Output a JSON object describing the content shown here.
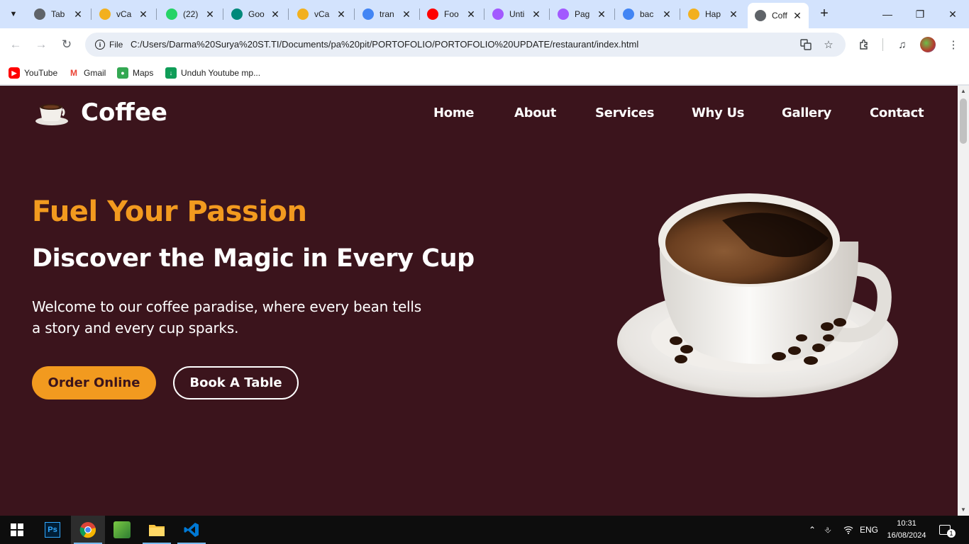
{
  "browser": {
    "tabs": [
      {
        "title": "Tab",
        "favicon": "chrome-icon",
        "color": "#5f6368"
      },
      {
        "title": "vCa",
        "favicon": "vcard-icon",
        "color": "#f2b01e"
      },
      {
        "title": "(22)",
        "favicon": "whatsapp-icon",
        "color": "#25d366"
      },
      {
        "title": "Goo",
        "favicon": "google-meet-icon",
        "color": "#00897b"
      },
      {
        "title": "vCa",
        "favicon": "vcard-icon",
        "color": "#f2b01e"
      },
      {
        "title": "tran",
        "favicon": "google-icon",
        "color": "#4285f4"
      },
      {
        "title": "Foo",
        "favicon": "youtube-icon",
        "color": "#ff0000"
      },
      {
        "title": "Unti",
        "favicon": "figma-icon",
        "color": "#a259ff"
      },
      {
        "title": "Pag",
        "favicon": "figma-icon",
        "color": "#a259ff"
      },
      {
        "title": "bac",
        "favicon": "google-icon",
        "color": "#4285f4"
      },
      {
        "title": "Hap",
        "favicon": "happy-icon",
        "color": "#f2b01e"
      },
      {
        "title": "Coff",
        "favicon": "globe-icon",
        "color": "#5f6368"
      }
    ],
    "active_tab": 11,
    "url_scheme": "File",
    "url": "C:/Users/Darma%20Surya%20ST.TI/Documents/pa%20pit/PORTOFOLIO/PORTOFOLIO%20UPDATE/restaurant/index.html",
    "bookmarks": [
      {
        "label": "YouTube",
        "icon": "youtube-icon",
        "color": "#ff0000"
      },
      {
        "label": "Gmail",
        "icon": "gmail-icon",
        "color": "#ea4335"
      },
      {
        "label": "Maps",
        "icon": "maps-icon",
        "color": "#34a853"
      },
      {
        "label": "Unduh Youtube mp...",
        "icon": "download-icon",
        "color": "#0f9d58"
      }
    ]
  },
  "site": {
    "brand": "Coffee",
    "nav": [
      "Home",
      "About",
      "Services",
      "Why Us",
      "Gallery",
      "Contact"
    ],
    "hero": {
      "kicker": "Fuel Your Passion",
      "title": "Discover the Magic in Every Cup",
      "description": "Welcome to our coffee paradise, where every bean tells a story and every cup sparks.",
      "primary_button": "Order Online",
      "secondary_button": "Book A Table"
    },
    "colors": {
      "background": "#3b141c",
      "accent": "#f29a1f",
      "text": "#ffffff"
    }
  },
  "taskbar": {
    "apps": [
      "start-icon",
      "photoshop-icon",
      "chrome-icon",
      "scribus-icon",
      "file-explorer-icon",
      "vscode-icon"
    ],
    "language": "ENG",
    "time": "10:31",
    "date": "16/08/2024",
    "notification_count": "1"
  }
}
